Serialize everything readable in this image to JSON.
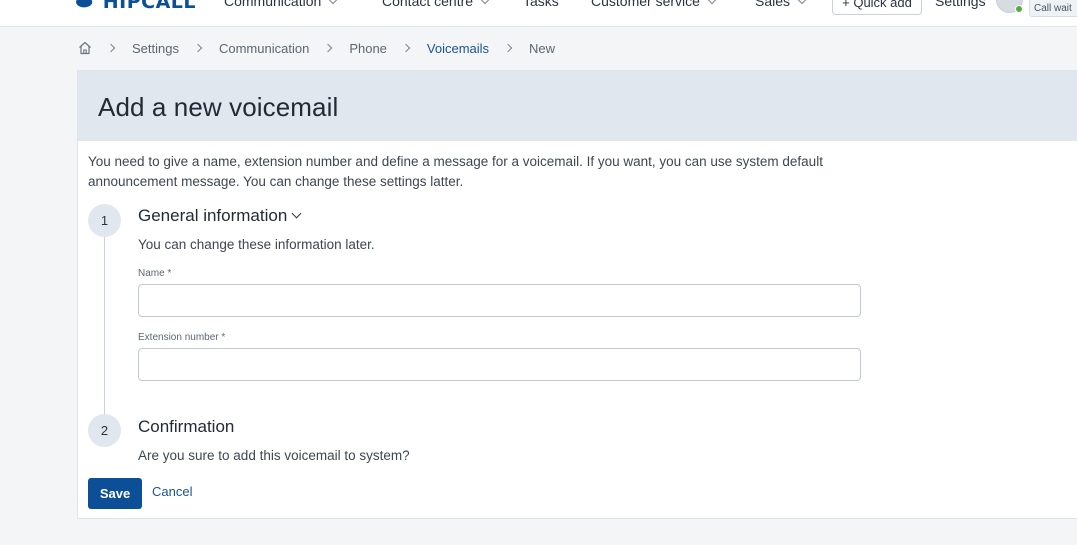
{
  "nav": {
    "logo_text": "HIPCALL",
    "items": [
      {
        "label": "Communication",
        "dropdown": true
      },
      {
        "label": "Contact centre",
        "dropdown": true
      },
      {
        "label": "Tasks",
        "dropdown": false
      },
      {
        "label": "Customer service",
        "dropdown": true
      },
      {
        "label": "Sales",
        "dropdown": true
      }
    ],
    "quick_add_label": "+ Quick add",
    "settings_label": "Settings",
    "user_status": "Call wait",
    "status_color": "#4fae3a"
  },
  "breadcrumb": [
    "Settings",
    "Communication",
    "Phone",
    "Voicemails",
    "New"
  ],
  "page": {
    "title": "Add a new voicemail",
    "intro": "You need to give a name, extension number and define a message for a voicemail. If you want, you can use system default announcement message. You can change these settings latter."
  },
  "steps": {
    "general": {
      "number": "1",
      "title": "General information",
      "description": "You can change these information later.",
      "name_label": "Name *",
      "name_value": "",
      "extension_label": "Extension number *",
      "extension_value": ""
    },
    "confirmation": {
      "number": "2",
      "title": "Confirmation",
      "description": "Are you sure to add this voicemail to system?"
    }
  },
  "actions": {
    "save_label": "Save",
    "cancel_label": "Cancel"
  },
  "colors": {
    "primary": "#0d4f96",
    "header_bg": "#e1e7ee",
    "link": "#1b5494"
  }
}
